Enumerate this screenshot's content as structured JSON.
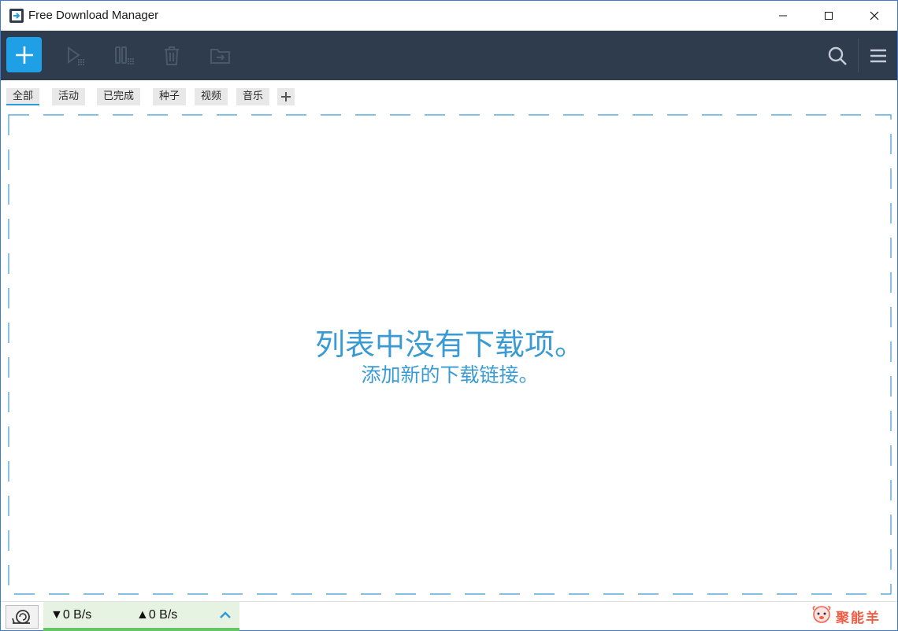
{
  "window": {
    "title": "Free Download Manager"
  },
  "toolbar": {
    "buttons": [
      {
        "name": "add-download-button",
        "icon": "plus-icon"
      },
      {
        "name": "resume-button",
        "icon": "play-grid-icon"
      },
      {
        "name": "pause-button",
        "icon": "pause-grid-icon"
      },
      {
        "name": "delete-button",
        "icon": "trash-icon"
      },
      {
        "name": "open-folder-button",
        "icon": "folder-arrow-icon"
      },
      {
        "name": "search-button",
        "icon": "search-icon"
      },
      {
        "name": "menu-button",
        "icon": "hamburger-icon"
      }
    ]
  },
  "tabs": [
    {
      "label": "全部",
      "active": true
    },
    {
      "label": "活动"
    },
    {
      "label": "已完成"
    },
    {
      "label": "种子"
    },
    {
      "label": "视频"
    },
    {
      "label": "音乐"
    }
  ],
  "empty": {
    "title": "列表中没有下载项。",
    "subtitle": "添加新的下载链接。"
  },
  "status": {
    "download_speed": "▼0 B/s",
    "upload_speed": "▲0 B/s"
  },
  "watermark": {
    "text": "聚能羊"
  },
  "colors": {
    "toolbar_bg": "#2f3c4e",
    "accent": "#1fa0e6",
    "empty_text": "#3a9bd3",
    "speed_bar": "#66c566"
  }
}
